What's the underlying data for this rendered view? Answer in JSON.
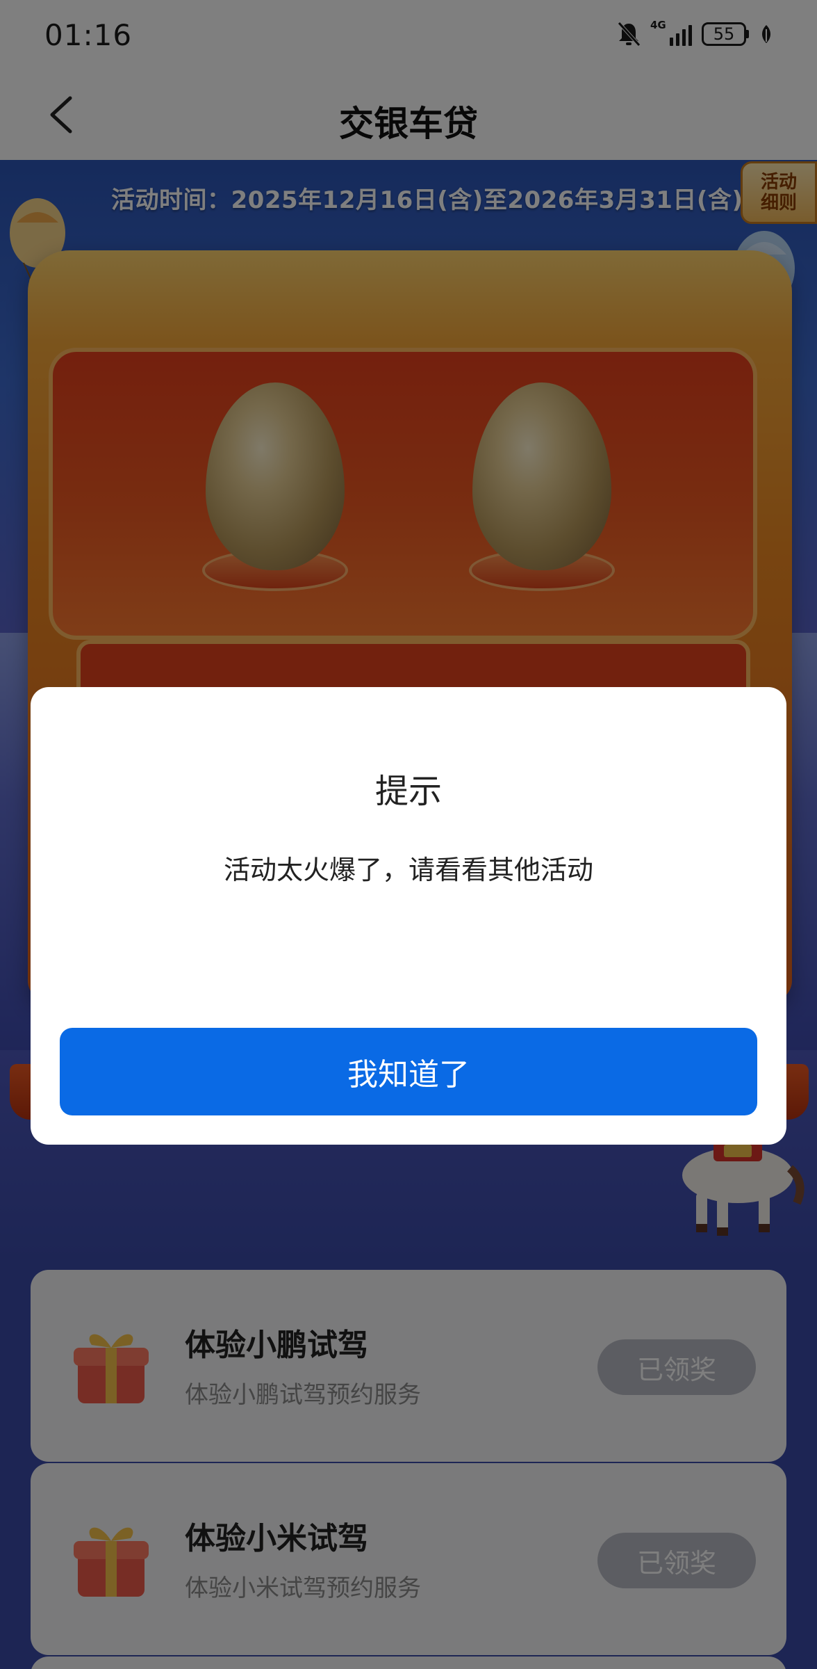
{
  "status_bar": {
    "time": "01:16",
    "network": "4G",
    "battery": "55",
    "icons": [
      "bell-muted-icon",
      "signal-icon",
      "battery-icon",
      "leaf-icon"
    ]
  },
  "nav": {
    "title": "交银车贷",
    "back_icon": "chevron-left-icon"
  },
  "banner": {
    "activity_time": "活动时间：2025年12月16日(含)至2026年3月31日(含)",
    "rules_label": "活动\n细则"
  },
  "dialog": {
    "title": "提示",
    "message": "活动太火爆了，请看看其他活动",
    "confirm_label": "我知道了",
    "button_color": "#0a6ae5"
  },
  "tasks": [
    {
      "title": "体验小鹏试驾",
      "description": "体验小鹏试驾预约服务",
      "status_label": "已领奖",
      "icon": "gift-icon"
    },
    {
      "title": "体验小米试驾",
      "description": "体验小米试驾预约服务",
      "status_label": "已领奖",
      "icon": "gift-icon"
    }
  ]
}
